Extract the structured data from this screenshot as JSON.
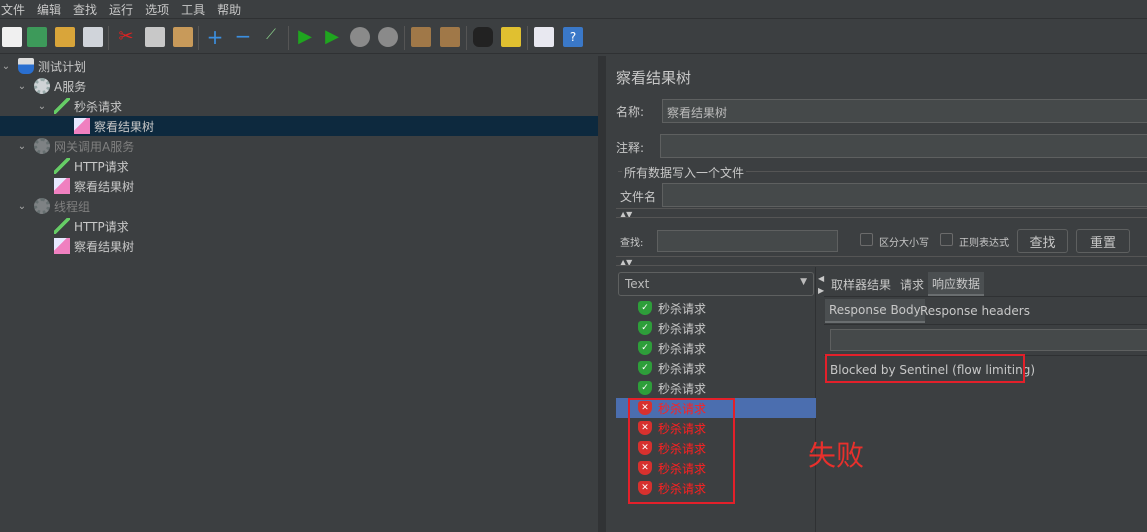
{
  "menu": [
    "文件",
    "编辑",
    "查找",
    "运行",
    "选项",
    "工具",
    "帮助"
  ],
  "tree": [
    {
      "label": "测试计划",
      "level": 0,
      "icon": "flask-icon",
      "disabled": false,
      "selected": false,
      "expanded": true
    },
    {
      "label": "A服务",
      "level": 1,
      "icon": "gear-icon",
      "disabled": false,
      "selected": false,
      "expanded": true
    },
    {
      "label": "秒杀请求",
      "level": 2,
      "icon": "pipette-icon",
      "disabled": false,
      "selected": false,
      "expanded": true
    },
    {
      "label": "察看结果树",
      "level": 3,
      "icon": "chart-icon",
      "disabled": false,
      "selected": true
    },
    {
      "label": "网关调用A服务",
      "level": 1,
      "icon": "gear-icon",
      "disabled": true,
      "selected": false,
      "expanded": true
    },
    {
      "label": "HTTP请求",
      "level": 2,
      "icon": "pipette-icon",
      "disabled": false,
      "selected": false
    },
    {
      "label": "察看结果树",
      "level": 2,
      "icon": "chart-icon",
      "disabled": false,
      "selected": false
    },
    {
      "label": "线程组",
      "level": 1,
      "icon": "gear-icon",
      "disabled": true,
      "selected": false,
      "expanded": true
    },
    {
      "label": "HTTP请求",
      "level": 2,
      "icon": "pipette-icon",
      "disabled": false,
      "selected": false
    },
    {
      "label": "察看结果树",
      "level": 2,
      "icon": "chart-icon",
      "disabled": false,
      "selected": false
    }
  ],
  "panel": {
    "title": "察看结果树",
    "name_label": "名称:",
    "name_value": "察看结果树",
    "comment_label": "注释:",
    "comment_value": "",
    "file_group": "所有数据写入一个文件",
    "filename_label": "文件名",
    "filename_value": "",
    "search_label": "查找:",
    "search_value": "",
    "case_label": "区分大小写",
    "regex_label": "正则表达式",
    "find_button": "查找",
    "reset_button": "重置",
    "renderer": "Text",
    "tabs": [
      "取样器结果",
      "请求",
      "响应数据"
    ],
    "subtabs": [
      "Response Body",
      "Response headers"
    ],
    "response_body": "Blocked by Sentinel (flow limiting)"
  },
  "results": [
    {
      "label": "秒杀请求",
      "status": "success"
    },
    {
      "label": "秒杀请求",
      "status": "success"
    },
    {
      "label": "秒杀请求",
      "status": "success"
    },
    {
      "label": "秒杀请求",
      "status": "success"
    },
    {
      "label": "秒杀请求",
      "status": "success"
    },
    {
      "label": "秒杀请求",
      "status": "fail",
      "selected": true
    },
    {
      "label": "秒杀请求",
      "status": "fail"
    },
    {
      "label": "秒杀请求",
      "status": "fail"
    },
    {
      "label": "秒杀请求",
      "status": "fail"
    },
    {
      "label": "秒杀请求",
      "status": "fail"
    }
  ],
  "annotation": "失败",
  "colors": {
    "annotation": "#e8302c",
    "success": "#2e9e3a",
    "fail": "#d7312e"
  }
}
